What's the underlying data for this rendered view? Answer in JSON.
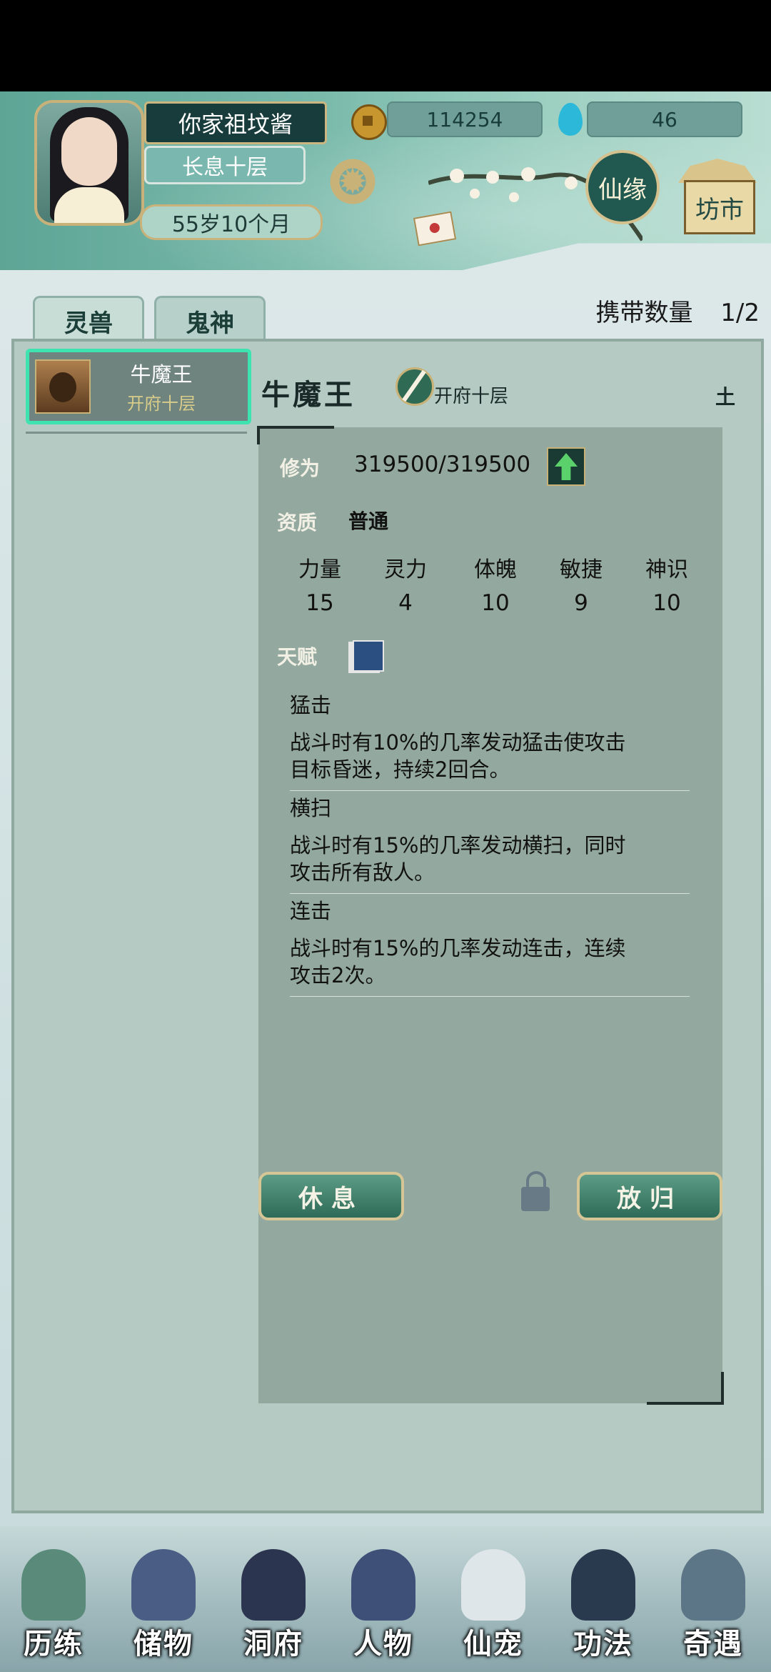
{
  "header": {
    "player_name": "你家祖坟酱",
    "realm": "长息十层",
    "age": "55岁10个月",
    "coins": "114254",
    "spirit_drops": "46",
    "xianyuan_label": "仙缘",
    "fangshi_label": "坊市"
  },
  "tabs": [
    {
      "label": "灵兽",
      "active": true
    },
    {
      "label": "鬼神",
      "active": false
    }
  ],
  "carry": {
    "label": "携带数量",
    "value": "1/2"
  },
  "pet_list": [
    {
      "name": "牛魔王",
      "realm": "开府十层",
      "selected": true
    }
  ],
  "detail": {
    "name": "牛魔王",
    "realm": "开府十层",
    "element": "土",
    "cultivation_label": "修为",
    "cultivation_value": "319500/319500",
    "aptitude_label": "资质",
    "aptitude_value": "普通",
    "stats": [
      {
        "label": "力量",
        "value": "15"
      },
      {
        "label": "灵力",
        "value": "4"
      },
      {
        "label": "体魄",
        "value": "10"
      },
      {
        "label": "敏捷",
        "value": "9"
      },
      {
        "label": "神识",
        "value": "10"
      }
    ],
    "talent_label": "天赋",
    "talents": [
      {
        "name": "猛击",
        "desc": "战斗时有10%的几率发动猛击使攻击目标昏迷，持续2回合。"
      },
      {
        "name": "横扫",
        "desc": "战斗时有15%的几率发动横扫，同时攻击所有敌人。"
      },
      {
        "name": "连击",
        "desc": "战斗时有15%的几率发动连击，连续攻击2次。"
      }
    ]
  },
  "actions": {
    "rest": "休息",
    "release": "放归"
  },
  "bottom_nav": [
    {
      "label": "历练",
      "color": "#5a8a7a"
    },
    {
      "label": "储物",
      "color": "#4a5d84"
    },
    {
      "label": "洞府",
      "color": "#2c3550"
    },
    {
      "label": "人物",
      "color": "#3e4f78"
    },
    {
      "label": "仙宠",
      "color": "#dfe6ea"
    },
    {
      "label": "功法",
      "color": "#2a3a4e"
    },
    {
      "label": "奇遇",
      "color": "#5c7688"
    }
  ]
}
